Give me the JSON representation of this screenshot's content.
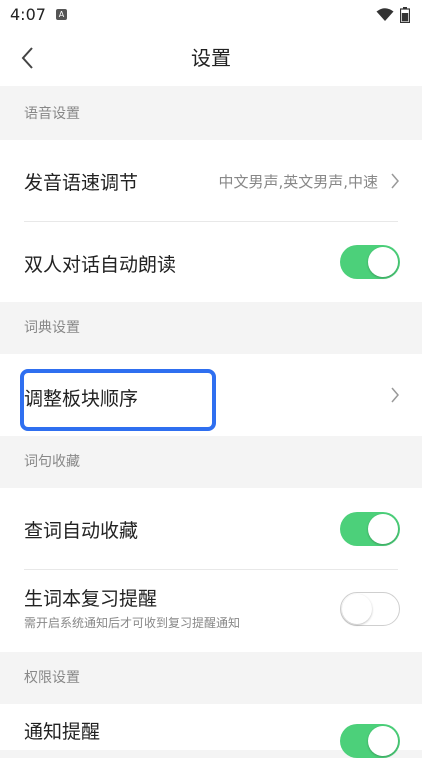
{
  "status_bar": {
    "time": "4:07",
    "app_icon": "A"
  },
  "header": {
    "title": "设置",
    "back_icon": "chevron-left-icon"
  },
  "sections": {
    "voice": {
      "title": "语音设置",
      "speed_label": "发音语速调节",
      "speed_value": "中文男声,英文男声,中速",
      "dialog_label": "双人对话自动朗读",
      "dialog_enabled": true
    },
    "dictionary": {
      "title": "词典设置",
      "order_label": "调整板块顺序"
    },
    "collection": {
      "title": "词句收藏",
      "auto_label": "查词自动收藏",
      "auto_enabled": true,
      "review_label": "生词本复习提醒",
      "review_sub": "需开启系统通知后才可收到复习提醒通知",
      "review_enabled": false
    },
    "permission": {
      "title": "权限设置",
      "notify_label": "通知提醒",
      "notify_enabled": true
    }
  },
  "colors": {
    "toggle_on": "#4cd07a",
    "highlight": "#2f6ff0"
  }
}
